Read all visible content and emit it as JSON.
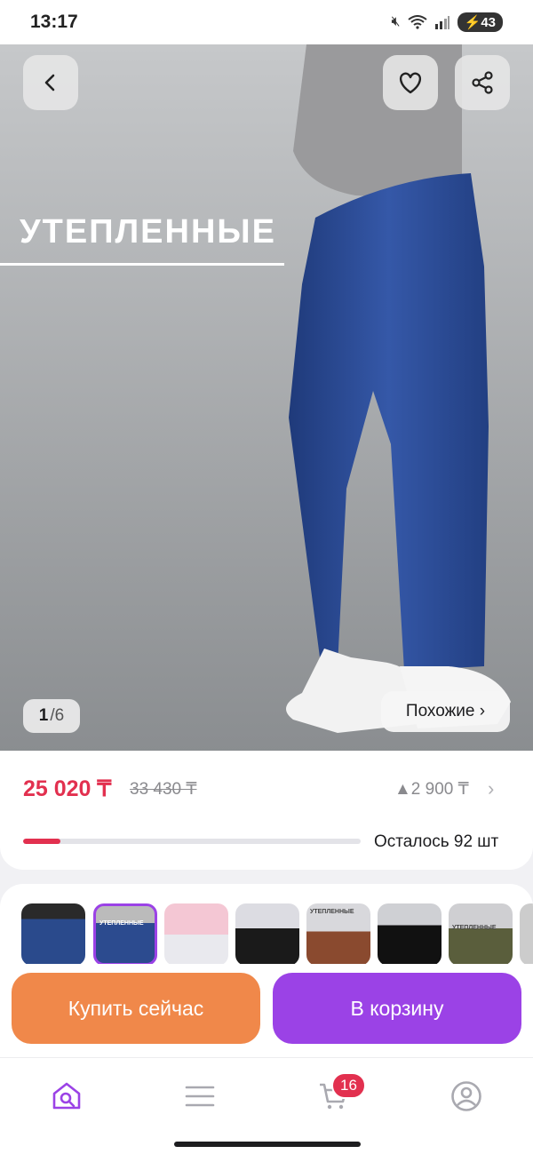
{
  "status_bar": {
    "time": "13:17",
    "battery": "43"
  },
  "product": {
    "banner": "УТЕПЛЕННЫЕ",
    "image_index": "1",
    "image_total": "/6",
    "similar_label": "Похожие ›"
  },
  "pricing": {
    "price": "25 020 ₸",
    "old_price": "33 430 ₸",
    "bonus": "▲2 900 ₸",
    "stock_label": "Осталось 92 шт",
    "colors": {
      "price": "#e2304f",
      "accent": "#9b42e6",
      "buy": "#f0884a"
    }
  },
  "thumbnails": {
    "count_visible": 8,
    "selected_index": 1,
    "thumb_texts": [
      "УТЕПЛЕННЫЕ",
      "УТЕПЛЕННЫЕ",
      "УТЕПЛЕННЫЕ"
    ]
  },
  "actions": {
    "buy_now": "Купить сейчас",
    "add_to_cart": "В корзину"
  },
  "tabbar": {
    "items": [
      {
        "icon": "home-search-icon"
      },
      {
        "icon": "menu-icon"
      },
      {
        "icon": "cart-icon",
        "badge": "16"
      },
      {
        "icon": "profile-icon"
      }
    ]
  }
}
